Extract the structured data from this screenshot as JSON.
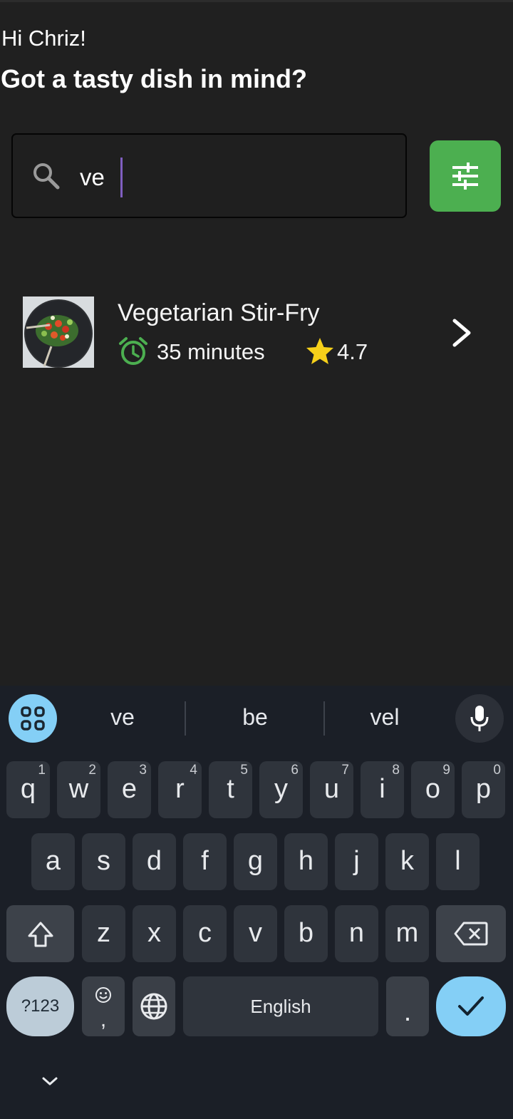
{
  "greeting": "Hi Chriz!",
  "headline": "Got a tasty dish in mind?",
  "search": {
    "value": "ve",
    "icon": "search-icon"
  },
  "filter_button": {
    "icon": "tune-sliders-icon",
    "color": "#4caf50"
  },
  "results": [
    {
      "title": "Vegetarian Stir-Fry",
      "time": "35 minutes",
      "rating": "4.7",
      "image": "stir-fry-bowl"
    }
  ],
  "keyboard": {
    "suggestions": [
      "ve",
      "be",
      "vel"
    ],
    "row1": [
      {
        "key": "q",
        "hint": "1"
      },
      {
        "key": "w",
        "hint": "2"
      },
      {
        "key": "e",
        "hint": "3"
      },
      {
        "key": "r",
        "hint": "4"
      },
      {
        "key": "t",
        "hint": "5"
      },
      {
        "key": "y",
        "hint": "6"
      },
      {
        "key": "u",
        "hint": "7"
      },
      {
        "key": "i",
        "hint": "8"
      },
      {
        "key": "o",
        "hint": "9"
      },
      {
        "key": "p",
        "hint": "0"
      }
    ],
    "row2": [
      "a",
      "s",
      "d",
      "f",
      "g",
      "h",
      "j",
      "k",
      "l"
    ],
    "row3": [
      "z",
      "x",
      "c",
      "v",
      "b",
      "n",
      "m"
    ],
    "symbols_label": "?123",
    "emoji_comma": ",",
    "space_label": "English",
    "period": "."
  },
  "colors": {
    "background": "#202020",
    "accent_green": "#4caf50",
    "star": "#f6d01a",
    "keyboard_bg": "#1b1f27",
    "key_bg": "#2f343c",
    "enter_bg": "#84cff6"
  }
}
